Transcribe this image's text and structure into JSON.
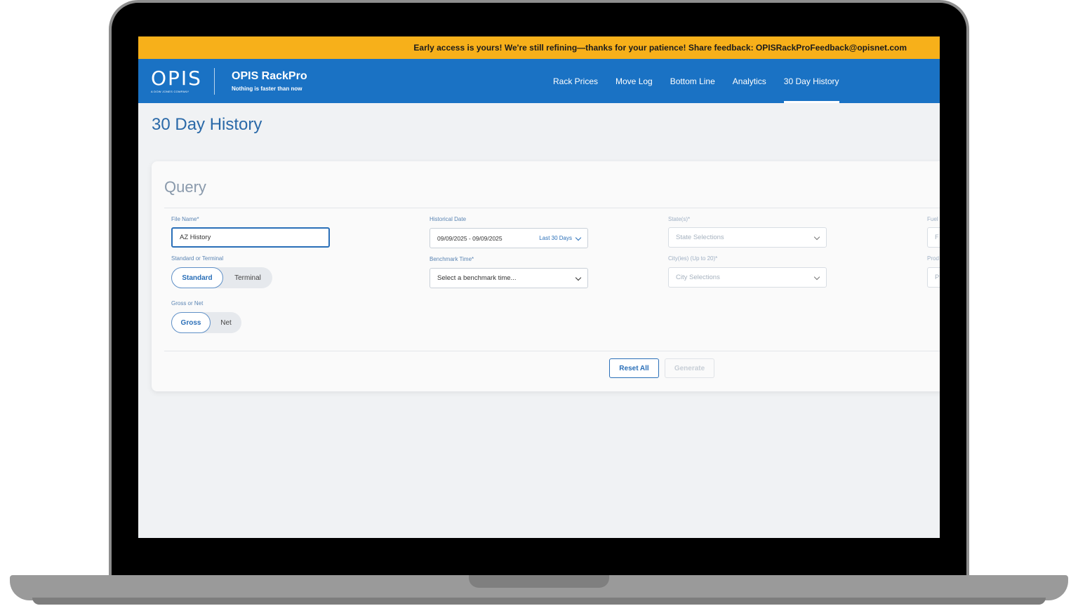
{
  "banner": {
    "text": "Early access is yours! We're still refining—thanks for your patience! Share feedback: OPISRackProFeedback@opisnet.com"
  },
  "header": {
    "logo_text": "OPIS",
    "logo_sub": "A DOW JONES COMPANY",
    "product_name": "OPIS RackPro",
    "product_tagline": "Nothing is faster than now",
    "nav": [
      {
        "label": "Rack Prices"
      },
      {
        "label": "Move Log"
      },
      {
        "label": "Bottom Line"
      },
      {
        "label": "Analytics"
      },
      {
        "label": "30 Day History",
        "active": true
      }
    ]
  },
  "page": {
    "title": "30 Day History"
  },
  "query": {
    "title": "Query",
    "file_name": {
      "label": "File Name*",
      "value": "AZ History"
    },
    "standard_or_terminal": {
      "label": "Standard or Terminal",
      "options": [
        "Standard",
        "Terminal"
      ],
      "selected": "Standard"
    },
    "gross_or_net": {
      "label": "Gross or Net",
      "options": [
        "Gross",
        "Net"
      ],
      "selected": "Gross"
    },
    "historical_date": {
      "label": "Historical Date",
      "value": "09/09/2025 - 09/09/2025",
      "preset": "Last 30 Days"
    },
    "benchmark_time": {
      "label": "Benchmark Time*",
      "placeholder": "Select a benchmark time..."
    },
    "states": {
      "label": "State(s)*",
      "placeholder": "State Selections"
    },
    "cities": {
      "label": "City(ies) (Up to 20)*",
      "placeholder": "City Selections"
    },
    "fuel_partial": {
      "label": "Fuel",
      "placeholder": "F"
    },
    "product_partial": {
      "label": "Prod",
      "placeholder": "P"
    },
    "reset_label": "Reset All",
    "generate_label": "Generate"
  }
}
